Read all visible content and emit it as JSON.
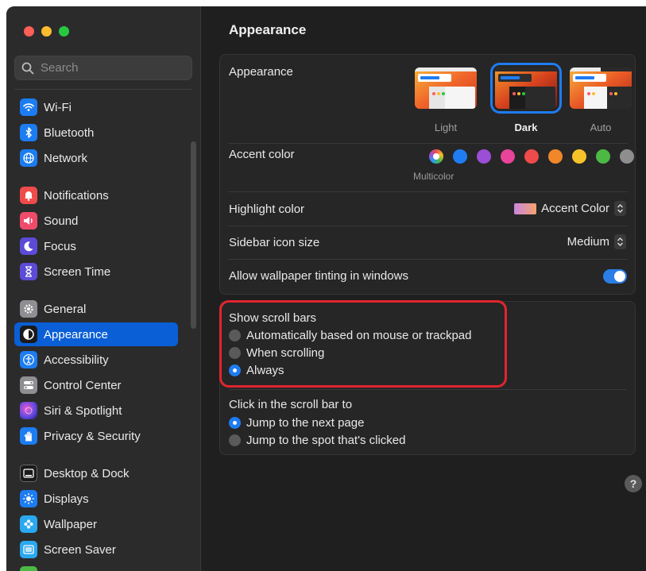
{
  "search": {
    "placeholder": "Search"
  },
  "sidebar": {
    "items": [
      {
        "label": "Wi-Fi",
        "icon": "wifi-icon",
        "color": "#1c7cf2"
      },
      {
        "label": "Bluetooth",
        "icon": "bluetooth-icon",
        "color": "#1c7cf2"
      },
      {
        "label": "Network",
        "icon": "globe-icon",
        "color": "#1c7cf2"
      },
      {
        "label": "Notifications",
        "icon": "bell-icon",
        "color": "#ef4b4b"
      },
      {
        "label": "Sound",
        "icon": "speaker-icon",
        "color": "#ef4b6b"
      },
      {
        "label": "Focus",
        "icon": "moon-icon",
        "color": "#5b4bd6"
      },
      {
        "label": "Screen Time",
        "icon": "hourglass-icon",
        "color": "#5b4bd6"
      },
      {
        "label": "General",
        "icon": "gear-icon",
        "color": "#8e8e93"
      },
      {
        "label": "Appearance",
        "icon": "appearance-icon",
        "color": "#1a1a1a",
        "selected": true
      },
      {
        "label": "Accessibility",
        "icon": "accessibility-icon",
        "color": "#1c7cf2"
      },
      {
        "label": "Control Center",
        "icon": "control-center-icon",
        "color": "#8e8e93"
      },
      {
        "label": "Siri & Spotlight",
        "icon": "siri-icon",
        "color": "#a84be0"
      },
      {
        "label": "Privacy & Security",
        "icon": "hand-icon",
        "color": "#1c7cf2"
      },
      {
        "label": "Desktop & Dock",
        "icon": "dock-icon",
        "color": "#1a1a1a"
      },
      {
        "label": "Displays",
        "icon": "sun-icon",
        "color": "#1c7cf2"
      },
      {
        "label": "Wallpaper",
        "icon": "flower-icon",
        "color": "#2aa8f0"
      },
      {
        "label": "Screen Saver",
        "icon": "screen-saver-icon",
        "color": "#2aa8f0"
      }
    ]
  },
  "main": {
    "title": "Appearance",
    "appearance": {
      "label": "Appearance",
      "options": [
        {
          "label": "Light",
          "selected": false
        },
        {
          "label": "Dark",
          "selected": true
        },
        {
          "label": "Auto",
          "selected": false
        }
      ]
    },
    "accent": {
      "label": "Accent color",
      "caption": "Multicolor",
      "colors": [
        "multicolor",
        "#1f7cf3",
        "#9b4ed6",
        "#e8449a",
        "#ef4b4b",
        "#f0872a",
        "#f6c22a",
        "#4cb944",
        "#8e8e8e"
      ]
    },
    "highlight": {
      "label": "Highlight color",
      "value": "Accent Color"
    },
    "sidebar_icon_size": {
      "label": "Sidebar icon size",
      "value": "Medium"
    },
    "wallpaper_tinting": {
      "label": "Allow wallpaper tinting in windows",
      "on": true
    },
    "scroll_bars": {
      "label": "Show scroll bars",
      "options": [
        {
          "label": "Automatically based on mouse or trackpad",
          "selected": false
        },
        {
          "label": "When scrolling",
          "selected": false
        },
        {
          "label": "Always",
          "selected": true
        }
      ]
    },
    "click_scroll": {
      "label": "Click in the scroll bar to",
      "options": [
        {
          "label": "Jump to the next page",
          "selected": true
        },
        {
          "label": "Jump to the spot that's clicked",
          "selected": false
        }
      ]
    },
    "help_label": "?"
  }
}
